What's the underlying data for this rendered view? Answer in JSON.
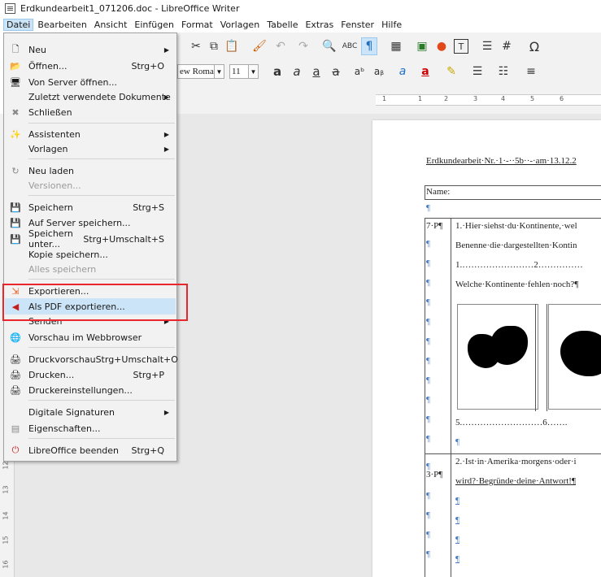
{
  "window": {
    "title": "Erdkundearbeit1_071206.doc - LibreOffice Writer"
  },
  "menubar": [
    "Datei",
    "Bearbeiten",
    "Ansicht",
    "Einfügen",
    "Format",
    "Vorlagen",
    "Tabelle",
    "Extras",
    "Fenster",
    "Hilfe"
  ],
  "active_menu": "Datei",
  "file_menu": {
    "items": [
      {
        "label": "Neu",
        "icon": "new-document-icon",
        "submenu": true
      },
      {
        "label": "Öffnen...",
        "icon": "open-folder-icon",
        "shortcut": "Strg+O"
      },
      {
        "label": "Von Server öffnen...",
        "icon": "server-icon"
      },
      {
        "label": "Zuletzt verwendete Dokumente",
        "submenu": true
      },
      {
        "label": "Schließen",
        "icon": "close-icon"
      },
      {
        "label": "Assistenten",
        "icon": "wizard-icon",
        "submenu": true
      },
      {
        "label": "Vorlagen",
        "submenu": true
      },
      {
        "label": "Neu laden",
        "icon": "reload-icon"
      },
      {
        "label": "Versionen...",
        "disabled": true
      },
      {
        "label": "Speichern",
        "icon": "save-icon",
        "shortcut": "Strg+S"
      },
      {
        "label": "Auf Server speichern...",
        "icon": "save-server-icon"
      },
      {
        "label": "Speichern unter...",
        "icon": "save-as-icon",
        "shortcut": "Strg+Umschalt+S"
      },
      {
        "label": "Kopie speichern..."
      },
      {
        "label": "Alles speichern",
        "disabled": true
      },
      {
        "label": "Exportieren...",
        "icon": "export-icon"
      },
      {
        "label": "Als PDF exportieren...",
        "icon": "pdf-icon",
        "highlighted": true
      },
      {
        "label": "Senden",
        "submenu": true
      },
      {
        "label": "Vorschau im Webbrowser",
        "icon": "web-preview-icon"
      },
      {
        "label": "Druckvorschau",
        "icon": "print-preview-icon",
        "shortcut": "Strg+Umschalt+O"
      },
      {
        "label": "Drucken...",
        "icon": "printer-icon",
        "shortcut": "Strg+P"
      },
      {
        "label": "Druckereinstellungen...",
        "icon": "printer-settings-icon"
      },
      {
        "label": "Digitale Signaturen",
        "submenu": true
      },
      {
        "label": "Eigenschaften...",
        "icon": "properties-icon"
      },
      {
        "label": "LibreOffice beenden",
        "icon": "exit-icon",
        "shortcut": "Strg+Q"
      }
    ]
  },
  "toolbar": {
    "font_name": "ew Roman",
    "font_size": "11"
  },
  "ruler": {
    "numbers": [
      "1",
      "1",
      "2",
      "3",
      "4",
      "5",
      "6"
    ]
  },
  "vruler": {
    "numbers": [
      "12",
      "13",
      "14",
      "15",
      "16"
    ]
  },
  "document": {
    "heading": "Erdkundearbeit·Nr.·1·-··5b··-·am·13.12.2",
    "name_label": "Name:",
    "q1_points": "7·P¶",
    "q1_line1": "1.·Hier·siehst·du·Kontinente,·wel",
    "q1_line2": "Benenne·die·dargestellten·Kontin",
    "q1_line3": "1.……………………2……………",
    "q1_line4": "Welche·Kontinente·fehlen·noch?¶",
    "q1_line5": "5.………………………6…….",
    "q2_points": "3·P¶",
    "q2_line1": "2.·Ist·in·Amerika·morgens·oder·i",
    "q2_line2": "wird?·Begründe·deine·Antwort!¶"
  },
  "colors": {
    "highlight_box": "#e8262b",
    "menu_hover": "#cce4f7",
    "para_mark": "#4a7fc7"
  }
}
